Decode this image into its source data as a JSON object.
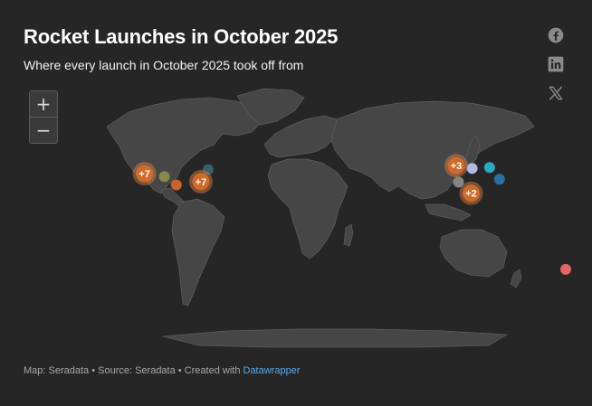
{
  "header": {
    "title": "Rocket Launches in October 2025",
    "subtitle": "Where every launch in October 2025 took off from"
  },
  "share": [
    {
      "name": "facebook-icon"
    },
    {
      "name": "linkedin-icon"
    },
    {
      "name": "x-icon"
    }
  ],
  "zoom": {
    "in_label": "+",
    "out_label": "−"
  },
  "colors": {
    "background": "#262626",
    "land": "#464646",
    "border": "#5e5e5e",
    "cluster_fill": "#cf6a2a",
    "cluster_ring": "#e0864a"
  },
  "map": {
    "clusters": [
      {
        "label": "+7",
        "lon": -120.6,
        "lat": 34.7
      },
      {
        "label": "+7",
        "lon": -80.6,
        "lat": 28.5
      },
      {
        "label": "+3",
        "lon": 100.3,
        "lat": 40.9
      },
      {
        "label": "+2",
        "lon": 110.9,
        "lat": 19.6
      }
    ],
    "sites": [
      {
        "lon": -106.5,
        "lat": 32.5,
        "color": "#8c8c4a"
      },
      {
        "lon": -98.0,
        "lat": 26.0,
        "color": "#d4652c"
      },
      {
        "lon": -75.5,
        "lat": 37.9,
        "color": "#3d6070"
      },
      {
        "lon": 111.6,
        "lat": 38.8,
        "color": "#b5c2ee"
      },
      {
        "lon": 124.0,
        "lat": 39.5,
        "color": "#2bb0c8"
      },
      {
        "lon": 102.0,
        "lat": 28.2,
        "color": "#8a8a8a"
      },
      {
        "lon": 131.0,
        "lat": 30.4,
        "color": "#2a74a8"
      },
      {
        "lon": 177.9,
        "lat": -39.3,
        "color": "#ee6a66"
      }
    ]
  },
  "footer": {
    "prefix": "Map: Seradata • Source: Seradata • Created with ",
    "link": "Datawrapper"
  }
}
